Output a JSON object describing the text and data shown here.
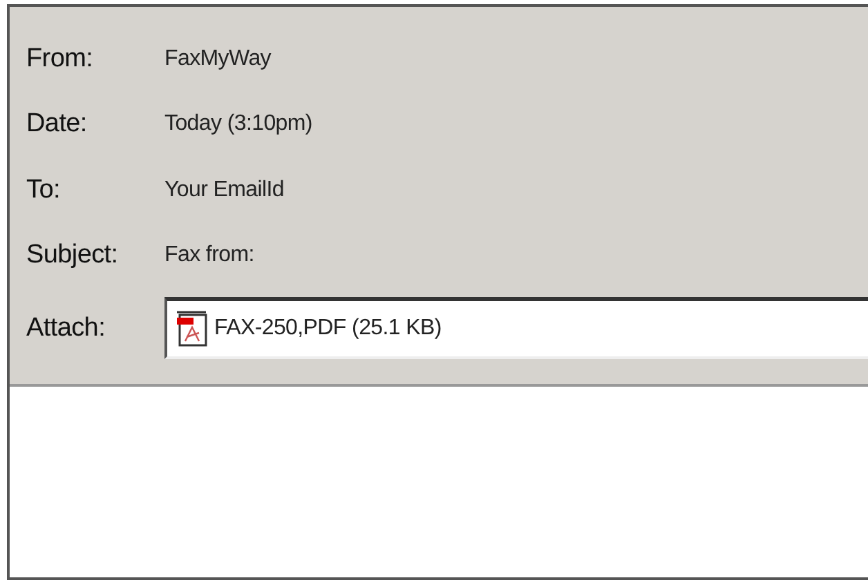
{
  "header_fields": [
    {
      "label": "From:",
      "value": "FaxMyWay"
    },
    {
      "label": "Date:",
      "value": "Today (3:10pm)"
    },
    {
      "label": "To:",
      "value": "Your EmailId"
    },
    {
      "label": "Subject:",
      "value": "Fax from:"
    }
  ],
  "attachment": {
    "label": "Attach:",
    "file": "FAX-250,PDF (25.1 KB)"
  }
}
